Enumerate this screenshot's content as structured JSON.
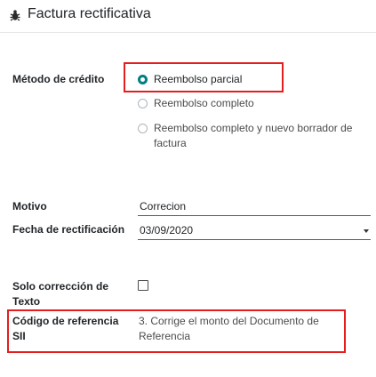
{
  "header": {
    "title": "Factura rectificativa",
    "icon": "bug-icon"
  },
  "credit_method": {
    "label": "Método de crédito",
    "options": [
      {
        "label": "Reembolso parcial",
        "selected": true
      },
      {
        "label": "Reembolso completo",
        "selected": false
      },
      {
        "label_line1": "Reembolso completo y nuevo borrador de",
        "label_line2": "factura",
        "selected": false
      }
    ]
  },
  "reason": {
    "label": "Motivo",
    "value": "Correcion"
  },
  "reversal_date": {
    "label": "Fecha de rectificación",
    "value": "03/09/2020"
  },
  "text_correction": {
    "label_line1": "Solo corrección de",
    "label_line2": "Texto",
    "checked": false
  },
  "sii_reference": {
    "label_line1": "Código de referencia",
    "label_line2": "SII",
    "value_line1": "3. Corrige el monto del Documento de",
    "value_line2": "Referencia"
  },
  "colors": {
    "accent": "#017e84",
    "highlight": "#e41e1e"
  }
}
